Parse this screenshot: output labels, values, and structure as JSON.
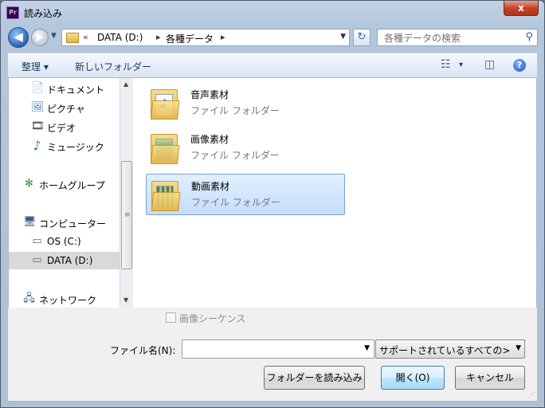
{
  "window": {
    "title": "読み込み",
    "app_icon_text": "Pr",
    "close_label": "x"
  },
  "nav": {
    "back_glyph": "◀",
    "forward_glyph": "▶",
    "breadcrumb_prefix": "«",
    "breadcrumbs": [
      "DATA (D:)",
      "各種データ"
    ],
    "search_placeholder": "各種データの検索"
  },
  "toolbar": {
    "organize_label": "整理 ▾",
    "new_folder_label": "新しいフォルダー",
    "view_dropdown": "▾"
  },
  "nav_pane": {
    "items": [
      {
        "label": "ドキュメント",
        "icon": "document-icon",
        "glyph": "📄"
      },
      {
        "label": "ピクチャ",
        "icon": "pictures-icon",
        "glyph": "🖼"
      },
      {
        "label": "ビデオ",
        "icon": "video-icon",
        "glyph": "🎞"
      },
      {
        "label": "ミュージック",
        "icon": "music-icon",
        "glyph": "♪"
      },
      {
        "label": "ホームグループ",
        "icon": "homegroup-icon",
        "glyph": "✻"
      },
      {
        "label": "コンピューター",
        "icon": "computer-icon",
        "glyph": "🖥"
      },
      {
        "label": "OS (C:)",
        "icon": "drive-c-icon",
        "glyph": "▭"
      },
      {
        "label": "DATA (D:)",
        "icon": "drive-d-icon",
        "glyph": "▭"
      },
      {
        "label": "ネットワーク",
        "icon": "network-icon",
        "glyph": "🖧"
      }
    ]
  },
  "content": {
    "folders": [
      {
        "name": "音声素材",
        "type": "ファイル フォルダー",
        "preview": "mp3"
      },
      {
        "name": "画像素材",
        "type": "ファイル フォルダー",
        "preview": "image"
      },
      {
        "name": "動画素材",
        "type": "ファイル フォルダー",
        "preview": "video"
      }
    ],
    "selected_folder": "動画素材"
  },
  "bottom": {
    "sequence_label": "画像シーケンス",
    "filename_label": "ファイル名(N):",
    "filename_value": "",
    "file_type_selected": "サポートされているすべての>",
    "import_folder_button": "フォルダーを読み込み",
    "open_button": "開く(O)",
    "cancel_button": "キャンセル"
  }
}
